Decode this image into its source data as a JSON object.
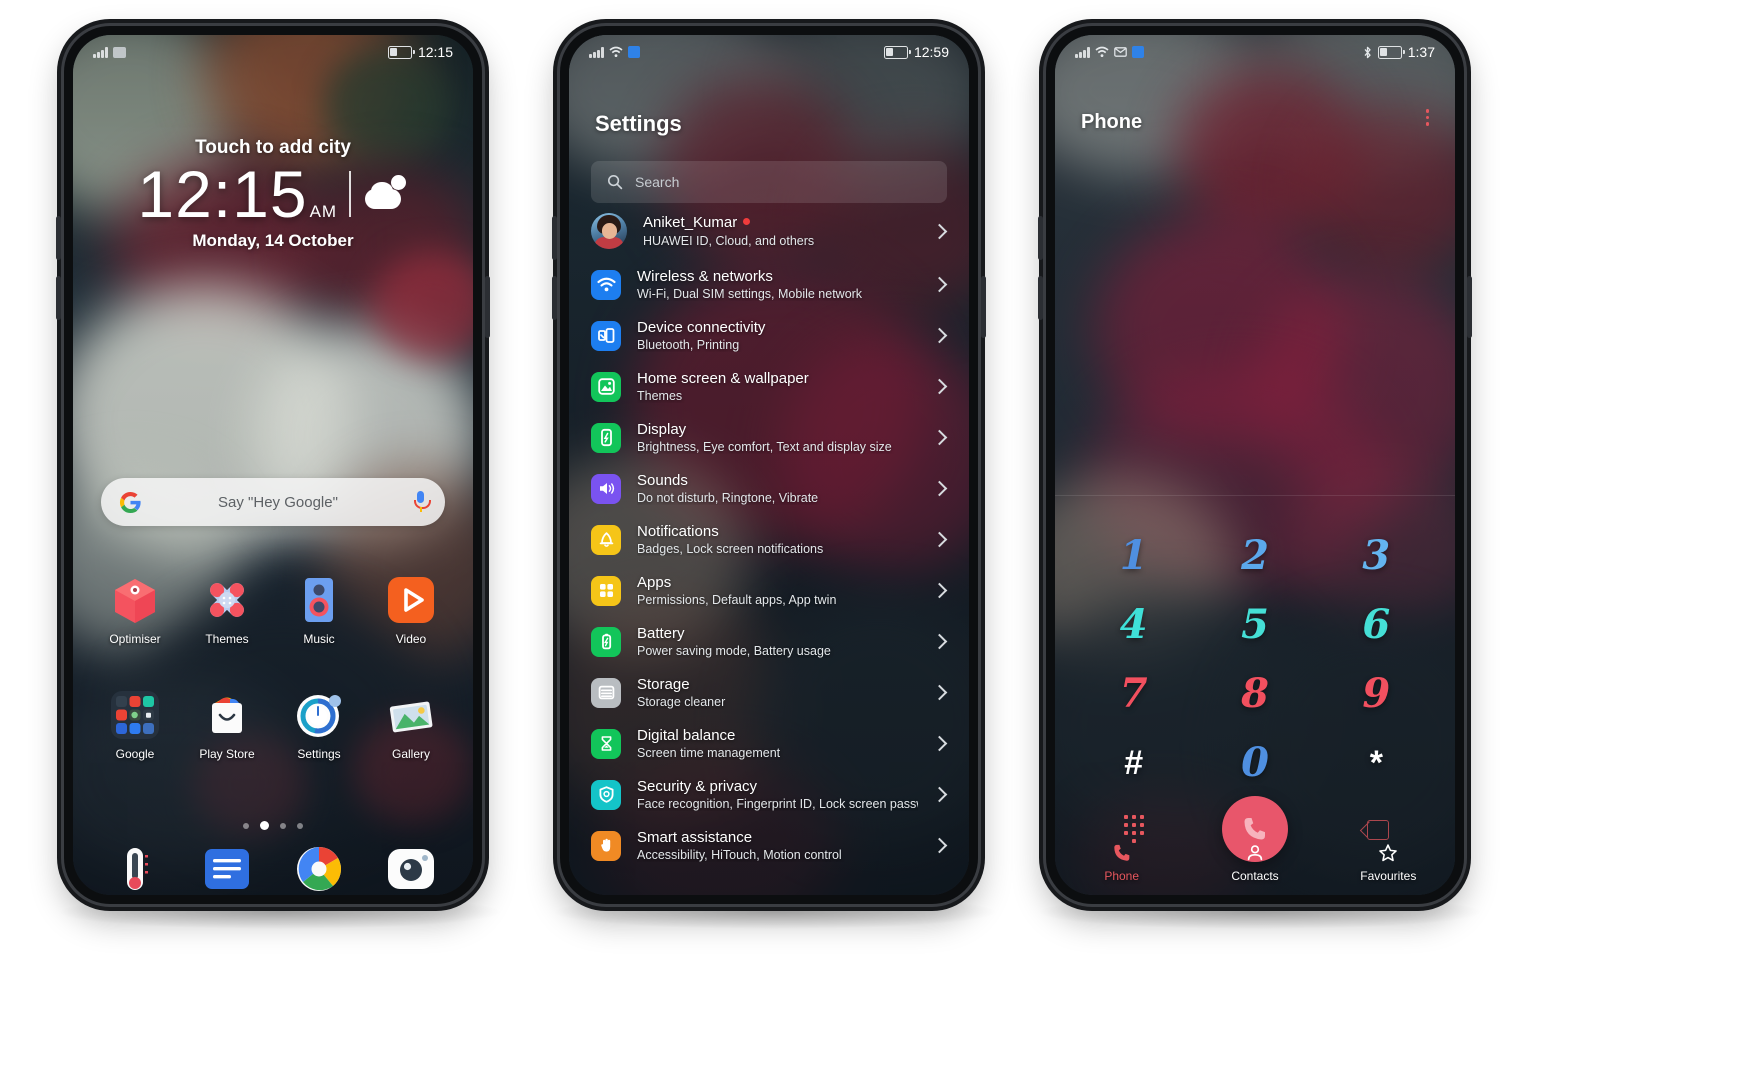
{
  "phones": {
    "lockscreen": {
      "status": {
        "time": "12:15",
        "icons": [
          "signal-bars",
          "sim-icon",
          "battery-charging"
        ]
      },
      "widget": {
        "city_prompt": "Touch to add city",
        "time": "12:15",
        "ampm": "AM",
        "date": "Monday, 14 October",
        "weather_icon": "partly-cloudy-icon"
      },
      "search_widget": {
        "logo": "google-logo",
        "hint": "Say \"Hey Google\"",
        "mic": "microphone-icon"
      },
      "apps_row1": [
        {
          "label": "Optimiser",
          "icon": "optimiser-icon"
        },
        {
          "label": "Themes",
          "icon": "themes-icon"
        },
        {
          "label": "Music",
          "icon": "music-icon"
        },
        {
          "label": "Video",
          "icon": "video-icon"
        }
      ],
      "apps_row2": [
        {
          "label": "Google",
          "icon": "google-folder-icon"
        },
        {
          "label": "Play Store",
          "icon": "play-store-icon"
        },
        {
          "label": "Settings",
          "icon": "settings-icon"
        },
        {
          "label": "Gallery",
          "icon": "gallery-icon"
        }
      ],
      "page_dots": {
        "count": 4,
        "active_index": 1
      },
      "dock": [
        {
          "label": "Thermometer",
          "icon": "thermometer-icon"
        },
        {
          "label": "Messages",
          "icon": "messages-icon"
        },
        {
          "label": "Browser",
          "icon": "browser-icon"
        },
        {
          "label": "Camera",
          "icon": "camera-icon"
        }
      ]
    },
    "settings": {
      "status": {
        "time": "12:59",
        "icons": [
          "signal-bars",
          "wifi-icon",
          "app-badge",
          "battery-charging"
        ]
      },
      "title": "Settings",
      "search": {
        "placeholder": "Search",
        "icon": "search-icon"
      },
      "account": {
        "name": "Aniket_Kumar",
        "subtitle": "HUAWEI ID, Cloud, and others",
        "avatar": "user-avatar",
        "badge": "red-dot"
      },
      "items": [
        {
          "title": "Wireless & networks",
          "subtitle": "Wi-Fi, Dual SIM settings, Mobile network",
          "icon": "wifi-icon",
          "color": "#1d7ef0"
        },
        {
          "title": "Device connectivity",
          "subtitle": "Bluetooth, Printing",
          "icon": "device-connectivity-icon",
          "color": "#1d7ef0"
        },
        {
          "title": "Home screen & wallpaper",
          "subtitle": "Themes",
          "icon": "wallpaper-icon",
          "color": "#12c55a"
        },
        {
          "title": "Display",
          "subtitle": "Brightness, Eye comfort, Text and display size",
          "icon": "display-icon",
          "color": "#12c55a"
        },
        {
          "title": "Sounds",
          "subtitle": "Do not disturb, Ringtone, Vibrate",
          "icon": "sound-icon",
          "color": "#7a53f0"
        },
        {
          "title": "Notifications",
          "subtitle": "Badges, Lock screen notifications",
          "icon": "bell-icon",
          "color": "#f5c518"
        },
        {
          "title": "Apps",
          "subtitle": "Permissions, Default apps, App twin",
          "icon": "apps-grid-icon",
          "color": "#f5c518"
        },
        {
          "title": "Battery",
          "subtitle": "Power saving mode, Battery usage",
          "icon": "battery-icon",
          "color": "#12c55a"
        },
        {
          "title": "Storage",
          "subtitle": "Storage cleaner",
          "icon": "storage-icon",
          "color": "#b9bdc1"
        },
        {
          "title": "Digital balance",
          "subtitle": "Screen time management",
          "icon": "hourglass-icon",
          "color": "#12c55a"
        },
        {
          "title": "Security & privacy",
          "subtitle": "Face recognition, Fingerprint ID, Lock screen password",
          "icon": "shield-icon",
          "color": "#14c4c8"
        },
        {
          "title": "Smart assistance",
          "subtitle": "Accessibility, HiTouch, Motion control",
          "icon": "hand-icon",
          "color": "#f08a24"
        }
      ],
      "chevron": "chevron-right-icon"
    },
    "dialer": {
      "status": {
        "time": "1:37",
        "icons": [
          "signal-bars",
          "wifi-icon",
          "mail-icon",
          "app-badge",
          "bluetooth-icon",
          "battery-icon"
        ]
      },
      "title": "Phone",
      "overflow": "more-options-icon",
      "keys": [
        [
          {
            "label": "1",
            "color": "#4f8fe0"
          },
          {
            "label": "2",
            "color": "#5ba8ec"
          },
          {
            "label": "3",
            "color": "#64b4ef"
          }
        ],
        [
          {
            "label": "4",
            "color": "#3fe0d8"
          },
          {
            "label": "5",
            "color": "#45dfd6"
          },
          {
            "label": "6",
            "color": "#45dfd6"
          }
        ],
        [
          {
            "label": "7",
            "color": "#f2505f"
          },
          {
            "label": "8",
            "color": "#f2505f"
          },
          {
            "label": "9",
            "color": "#f2505f"
          }
        ],
        [
          {
            "label": "#",
            "color": "#ffffff"
          },
          {
            "label": "0",
            "color": "#4f8fe0"
          },
          {
            "label": "*",
            "color": "#ffffff"
          }
        ]
      ],
      "actions": {
        "keypad_toggle": "dialpad-icon",
        "call": "call-icon",
        "delete": "backspace-icon"
      },
      "tabs": [
        {
          "label": "Phone",
          "icon": "phone-icon",
          "active": true,
          "color": "#e7575e"
        },
        {
          "label": "Contacts",
          "icon": "contacts-icon",
          "active": false,
          "color": "#ffffff"
        },
        {
          "label": "Favourites",
          "icon": "star-icon",
          "active": false,
          "color": "#ffffff"
        }
      ]
    }
  },
  "theme": {
    "accent_red": "#e7575e",
    "accent_blue": "#4f8fe0",
    "accent_cyan": "#45dfd6"
  }
}
